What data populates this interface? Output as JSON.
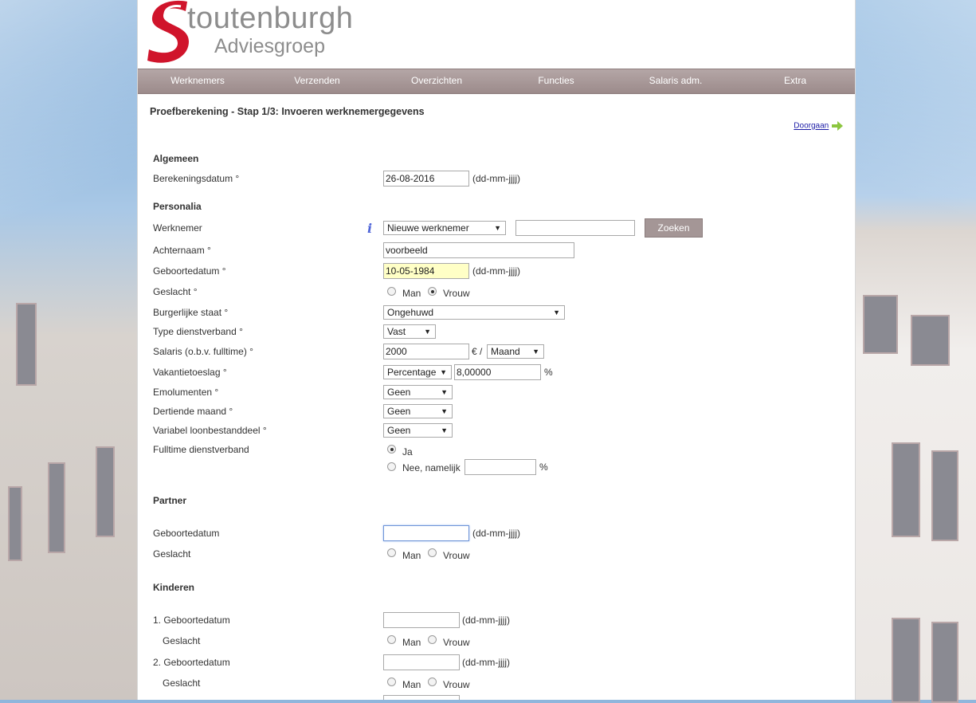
{
  "brand": {
    "name": "Stoutenburgh",
    "name_rest": "toutenburgh",
    "sub": "Adviesgroep"
  },
  "nav": [
    "Werknemers",
    "Verzenden",
    "Overzichten",
    "Functies",
    "Salaris adm.",
    "Extra"
  ],
  "page": {
    "title": "Proefberekening - Stap 1/3: Invoeren werknemergegevens",
    "next_link": "Doorgaan"
  },
  "sections": {
    "algemeen": "Algemeen",
    "personalia": "Personalia",
    "partner": "Partner",
    "kinderen": "Kinderen"
  },
  "algemeen": {
    "berekeningsdatum_label": "Berekeningsdatum °",
    "berekeningsdatum_value": "26-08-2016",
    "date_hint": "(dd-mm-jjjj)"
  },
  "personalia": {
    "werknemer_label": "Werknemer",
    "werknemer_select": "Nieuwe werknemer",
    "zoeken_button": "Zoeken",
    "info_icon": "i",
    "achternaam_label": "Achternaam °",
    "achternaam_value": "voorbeeld",
    "geboortedatum_label": "Geboortedatum °",
    "geboortedatum_value": "10-05-1984",
    "geslacht_label": "Geslacht °",
    "man": "Man",
    "vrouw": "Vrouw",
    "burgerlijke_label": "Burgerlijke staat °",
    "burgerlijke_value": "Ongehuwd",
    "type_label": "Type dienstverband °",
    "type_value": "Vast",
    "salaris_label": "Salaris (o.b.v. fulltime) °",
    "salaris_value": "2000",
    "salaris_unit": "€ /",
    "salaris_period": "Maand",
    "vakantie_label": "Vakantietoeslag °",
    "vakantie_type": "Percentage",
    "vakantie_value": "8,00000",
    "percent": "%",
    "emolumenten_label": "Emolumenten °",
    "emolumenten_value": "Geen",
    "dertiende_label": "Dertiende maand °",
    "dertiende_value": "Geen",
    "variabel_label": "Variabel loonbestanddeel °",
    "variabel_value": "Geen",
    "fulltime_label": "Fulltime dienstverband",
    "ja": "Ja",
    "nee": "Nee, namelijk"
  },
  "partner": {
    "geboortedatum_label": "Geboortedatum",
    "geslacht_label": "Geslacht"
  },
  "kinderen": {
    "k1_label": "1. Geboortedatum",
    "k2_label": "2. Geboortedatum",
    "geslacht_label": "Geslacht"
  },
  "colors": {
    "nav": "#9c8b8b",
    "logo_red": "#d0142b",
    "text": "#333333"
  }
}
